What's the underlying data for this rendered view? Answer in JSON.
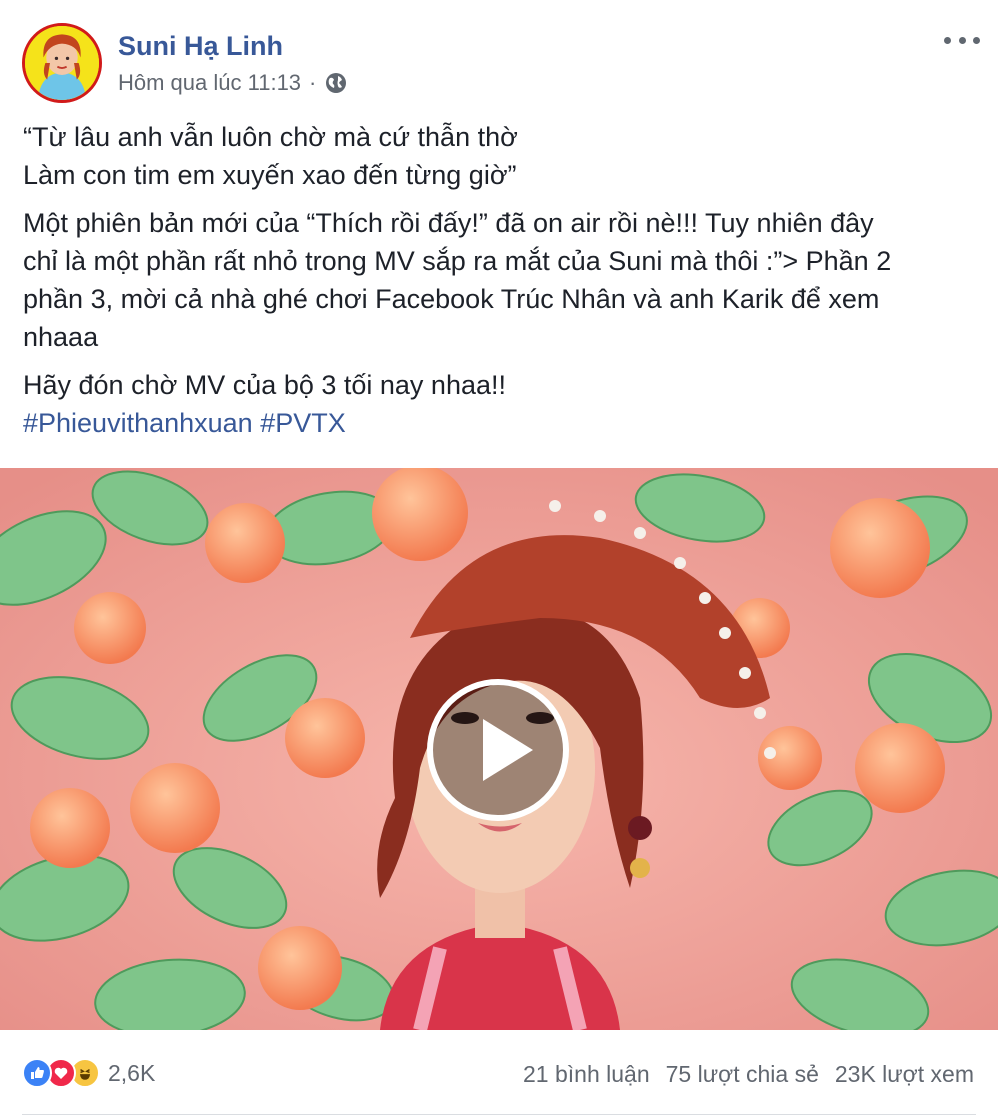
{
  "post": {
    "author": "Suni Hạ Linh",
    "time": "Hôm qua lúc 11:13",
    "separator": "·",
    "privacy_icon": "globe-icon",
    "more_icon": "more-options-icon",
    "lines": {
      "l1": "“Từ lâu anh vẫn luôn chờ mà cứ thẫn thờ",
      "l2": "Làm con tim em xuyến xao đến từng giờ”",
      "l3": "Một phiên bản mới của “Thích rồi đấy!” đã on air rồi nè!!! Tuy nhiên đây",
      "l4": "chỉ là một phần rất nhỏ trong MV sắp ra mắt của Suni mà thôi :”> Phần 2",
      "l5": "phần 3, mời cả nhà ghé chơi Facebook Trúc Nhân và anh Karik để xem",
      "l6": "nhaaa",
      "l7": "Hãy đón chờ MV của bộ 3 tối nay nhaa!!"
    },
    "hashtags": [
      "#Phieuvithanhxuan",
      "#PVTX"
    ]
  },
  "video": {
    "play_icon": "play-icon"
  },
  "footer": {
    "reactions": [
      "like-icon",
      "love-icon",
      "haha-icon"
    ],
    "reaction_count": "2,6K",
    "comments": "21 bình luận",
    "shares": "75 lượt chia sẻ",
    "views": "23K lượt xem"
  },
  "colors": {
    "link": "#385898",
    "meta": "#616770",
    "text": "#1d2129"
  }
}
